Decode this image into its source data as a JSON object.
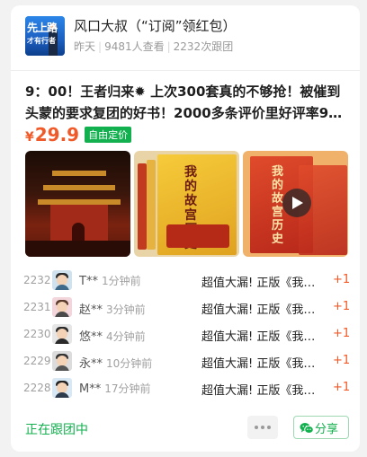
{
  "header": {
    "avatar_text_top": "先上路",
    "avatar_text_bottom": "才有行者",
    "title": "风口大叔（“订阅”领红包）",
    "when": "昨天",
    "views": "9481人查看",
    "joined": "2232次跟团"
  },
  "post": {
    "description": "9：00！王者归来✹ 上次300套真的不够抢！被催到头蒙的要求复团的好书！2000多条评价里好评率9…",
    "price_symbol": "¥",
    "price": "29.9",
    "price_tag": "自由定价"
  },
  "images": [
    {
      "icon": "palace-photo"
    },
    {
      "icon": "book-set-photo",
      "book_title": "我的故宫历史"
    },
    {
      "icon": "book-video-thumbnail",
      "book_title": "我的故宫历史"
    }
  ],
  "orders": [
    {
      "num": "2232",
      "name": "T**",
      "time": "1分钟前",
      "item": "超值大漏! 正版《我的故宫历史》",
      "qty": "+1"
    },
    {
      "num": "2231",
      "name": "赵**",
      "time": "3分钟前",
      "item": "超值大漏! 正版《我的故宫历史》",
      "qty": "+1"
    },
    {
      "num": "2230",
      "name": "悠**",
      "time": "4分钟前",
      "item": "超值大漏! 正版《我的故宫历史》",
      "qty": "+1"
    },
    {
      "num": "2229",
      "name": "永**",
      "time": "10分钟前",
      "item": "超值大漏! 正版《我的故宫历史》",
      "qty": "+1"
    },
    {
      "num": "2228",
      "name": "M**",
      "time": "17分钟前",
      "item": "超值大漏! 正版《我的故宫历史》",
      "qty": "+1"
    }
  ],
  "footer": {
    "status": "正在跟团中",
    "share_label": "分享"
  },
  "colors": {
    "accent_green": "#12b04e",
    "price_orange": "#f05a28"
  }
}
